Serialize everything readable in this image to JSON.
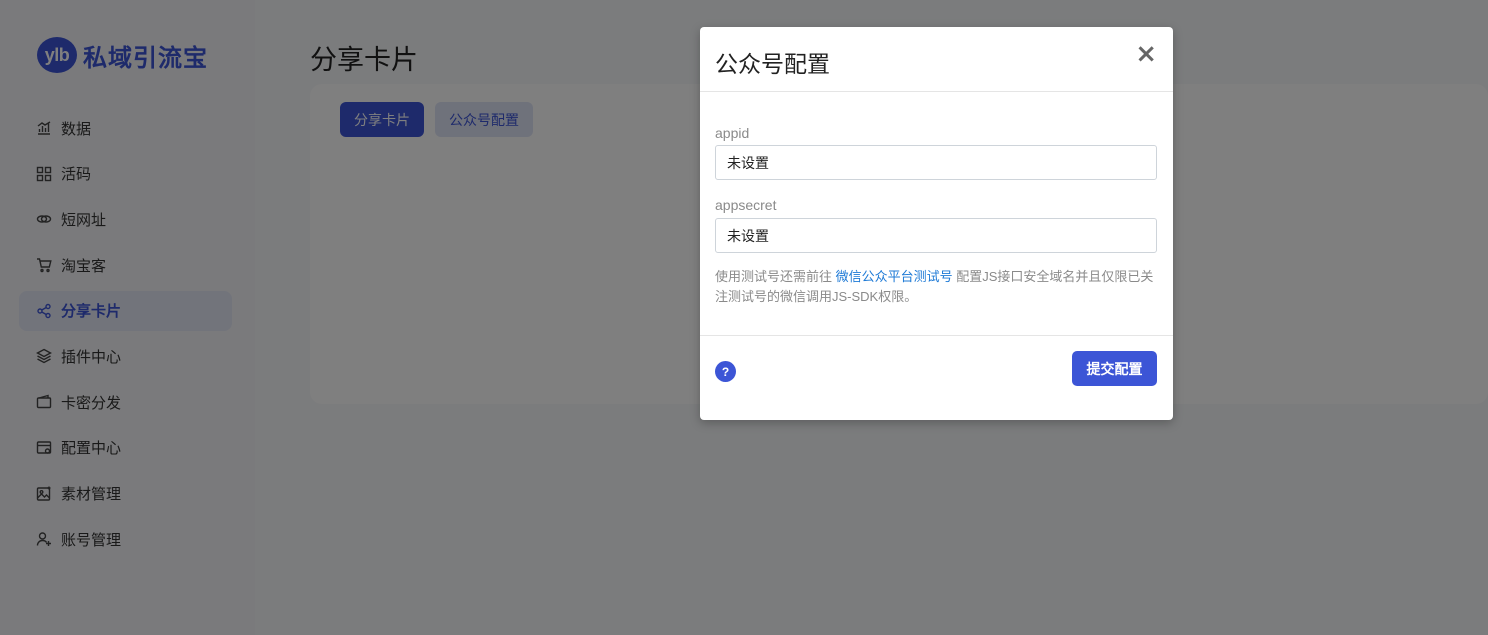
{
  "app": {
    "logo_badge": "ylb",
    "logo_text": "私域引流宝"
  },
  "sidebar": {
    "items": [
      {
        "label": "数据",
        "icon": "bar-chart-icon"
      },
      {
        "label": "活码",
        "icon": "qr-grid-icon"
      },
      {
        "label": "短网址",
        "icon": "link-icon"
      },
      {
        "label": "淘宝客",
        "icon": "cart-icon"
      },
      {
        "label": "分享卡片",
        "icon": "share-icon",
        "active": true
      },
      {
        "label": "插件中心",
        "icon": "layers-icon"
      },
      {
        "label": "卡密分发",
        "icon": "wallet-icon"
      },
      {
        "label": "配置中心",
        "icon": "settings-card-icon"
      },
      {
        "label": "素材管理",
        "icon": "image-icon"
      },
      {
        "label": "账号管理",
        "icon": "user-add-icon"
      }
    ]
  },
  "main": {
    "title": "分享卡片",
    "tabs": [
      {
        "label": "分享卡片"
      },
      {
        "label": "公众号配置"
      }
    ]
  },
  "modal": {
    "title": "公众号配置",
    "close_symbol": "×",
    "fields": [
      {
        "label": "appid",
        "value": "未设置"
      },
      {
        "label": "appsecret",
        "value": "未设置"
      }
    ],
    "help_prefix": "使用测试号还需前往 ",
    "help_link": "微信公众平台测试号",
    "help_suffix": " 配置JS接口安全域名并且仅限已关注测试号的微信调用JS-SDK权限。",
    "help_icon": "?",
    "submit_label": "提交配置"
  },
  "colors": {
    "accent": "#3c55d6",
    "link": "#1e7ad6",
    "overlay": "rgba(0,0,0,0.5)"
  }
}
